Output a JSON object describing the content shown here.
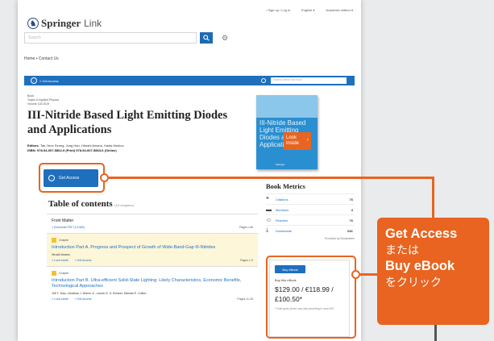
{
  "header": {
    "logo_word1": "Springer",
    "logo_word2": "Link",
    "top_links": [
      "› Sign up / Log in",
      "English ▾",
      "Academic edition ▾"
    ],
    "search_placeholder": "Search",
    "breadcrumb": "Home  •  Contact Us"
  },
  "bar": {
    "get_access": "» Get Access",
    "within_placeholder": "Search within this book"
  },
  "book": {
    "type": "Book",
    "series": "Topics in Applied Physics",
    "volume": "Volume 133 2019",
    "title": "III-Nitride Based Light Emitting Diodes and Applications",
    "editors_label": "Editors",
    "editors": "Tae-Yeon Seong, Jung Han, Hiroshi Amano, Hadis Morkoc",
    "isbn": "ISBN: 978-94-007-5862-9 (Print) 978-94-007-5863-6 (Online)",
    "cover_title": "III-Nitride Based Light Emitting Diodes and Applications",
    "cover_publisher": "Springer",
    "look_inside": "Look Inside",
    "get_access_button": "Get Access"
  },
  "toc": {
    "title": "Table of contents",
    "count": "(14 chapters)",
    "front_matter": "Front Matter",
    "front_download": "» Download PDF (1.6 MB)",
    "front_pages": "Pages i-xiii",
    "chapters": [
      {
        "tag": "Chapter",
        "title": "Introduction Part A. Progress and Prospect of Growth of Wide-Band-Gap III-Nitrides",
        "authors": "Hiroshi Amano",
        "look": "» Look Inside",
        "access": "» Get Access",
        "pages": "Pages 1-9"
      },
      {
        "tag": "Chapter",
        "title": "Introduction Part B. Ultra-efficient Solid-State Lighting: Likely Characteristics, Economic Benefits, Technological Approaches",
        "authors": "Jeff Y. Tsao, Jonathan J. Wierer Jr., Lauren E. S. Rohwer, Michael E. Coltrin...",
        "look": "» Look Inside",
        "access": "» Get Access",
        "pages": "Pages 11-26"
      }
    ]
  },
  "metrics": {
    "heading": "Book Metrics",
    "rows": [
      {
        "icon": "citations-icon",
        "label": "Citations",
        "value": "76"
      },
      {
        "icon": "mentions-icon",
        "label": "Mentions",
        "value": "3"
      },
      {
        "icon": "readers-icon",
        "label": "Readers",
        "value": "76"
      },
      {
        "icon": "downloads-icon",
        "label": "Downloads",
        "value": "31K"
      }
    ],
    "provided_by": "Provided by Bookmetrix"
  },
  "buy": {
    "button": "Buy eBook",
    "label": "Buy this eBook",
    "price": "$129.00 / €118.99 / £100.50*",
    "note": "* Final gross prices may vary according to local VAT."
  },
  "callout": {
    "line1": "Get Access",
    "line2": "または",
    "line3": "Buy eBook",
    "line4": "をクリック"
  },
  "colors": {
    "accent": "#e86420",
    "brand_blue": "#1e6fbe"
  }
}
